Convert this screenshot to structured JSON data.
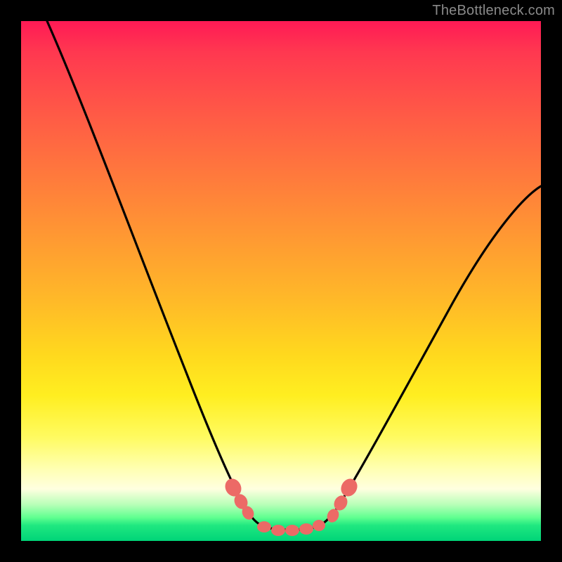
{
  "watermark": "TheBottleneck.com",
  "chart_data": {
    "type": "line",
    "title": "",
    "xlabel": "",
    "ylabel": "",
    "xlim": [
      0,
      1
    ],
    "ylim": [
      0,
      1
    ],
    "background_gradient": {
      "top_color": "#ff1a55",
      "bottom_color": "#00d478",
      "stops": [
        {
          "pos": 0.0,
          "color": "#ff1a55"
        },
        {
          "pos": 0.5,
          "color": "#ffba28"
        },
        {
          "pos": 0.85,
          "color": "#ffffb0"
        },
        {
          "pos": 1.0,
          "color": "#00d478"
        }
      ]
    },
    "series": [
      {
        "name": "bottleneck-curve",
        "x": [
          0.05,
          0.1,
          0.15,
          0.2,
          0.25,
          0.3,
          0.35,
          0.4,
          0.43,
          0.46,
          0.5,
          0.54,
          0.57,
          0.6,
          0.65,
          0.7,
          0.78,
          0.86,
          0.94,
          1.0
        ],
        "y": [
          1.0,
          0.87,
          0.74,
          0.6,
          0.47,
          0.33,
          0.21,
          0.11,
          0.06,
          0.03,
          0.02,
          0.03,
          0.06,
          0.11,
          0.2,
          0.31,
          0.44,
          0.55,
          0.63,
          0.68
        ]
      }
    ],
    "markers": [
      {
        "name": "left-bead-1",
        "x": 0.405,
        "y": 0.105,
        "r": 0.015
      },
      {
        "name": "left-bead-2",
        "x": 0.42,
        "y": 0.08,
        "r": 0.013
      },
      {
        "name": "left-bead-3",
        "x": 0.433,
        "y": 0.058,
        "r": 0.012
      },
      {
        "name": "flat-bead-1",
        "x": 0.465,
        "y": 0.028,
        "r": 0.012
      },
      {
        "name": "flat-bead-2",
        "x": 0.49,
        "y": 0.022,
        "r": 0.012
      },
      {
        "name": "flat-bead-3",
        "x": 0.515,
        "y": 0.022,
        "r": 0.012
      },
      {
        "name": "flat-bead-4",
        "x": 0.54,
        "y": 0.028,
        "r": 0.012
      },
      {
        "name": "right-bead-3",
        "x": 0.567,
        "y": 0.058,
        "r": 0.012
      },
      {
        "name": "right-bead-2",
        "x": 0.582,
        "y": 0.082,
        "r": 0.013
      },
      {
        "name": "right-bead-1",
        "x": 0.6,
        "y": 0.11,
        "r": 0.015
      }
    ],
    "marker_color": "#ec6a66",
    "curve_color": "#000000"
  }
}
